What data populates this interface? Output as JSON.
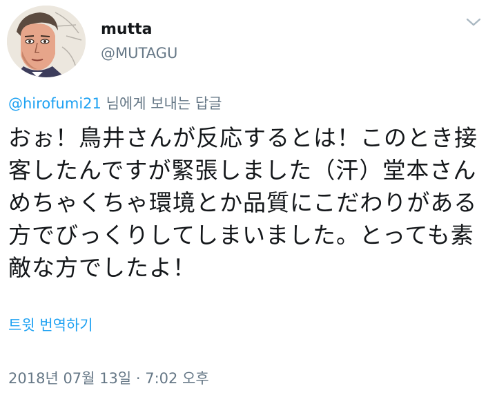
{
  "author": {
    "name": "mutta",
    "handle": "@MUTAGU"
  },
  "reply": {
    "mention": "@hirofumi21",
    "suffix": " 님에게 보내는 답글"
  },
  "tweet": {
    "text": "おぉ！鳥井さんが反応するとは！このとき接客したんですが緊張しました（汗）堂本さんめちゃくちゃ環境とか品質にこだわりがある方でびっくりしてしまいました。とっても素敵な方でしたよ！"
  },
  "translate": {
    "label": "트윗 번역하기"
  },
  "meta": {
    "timestamp": "2018년 07월 13일 · 7:02 오후"
  },
  "icons": {
    "menu": "chevron-down-icon",
    "avatar": "avatar"
  },
  "colors": {
    "link": "#1da1f2",
    "secondary": "#657786",
    "text": "#14171a"
  }
}
